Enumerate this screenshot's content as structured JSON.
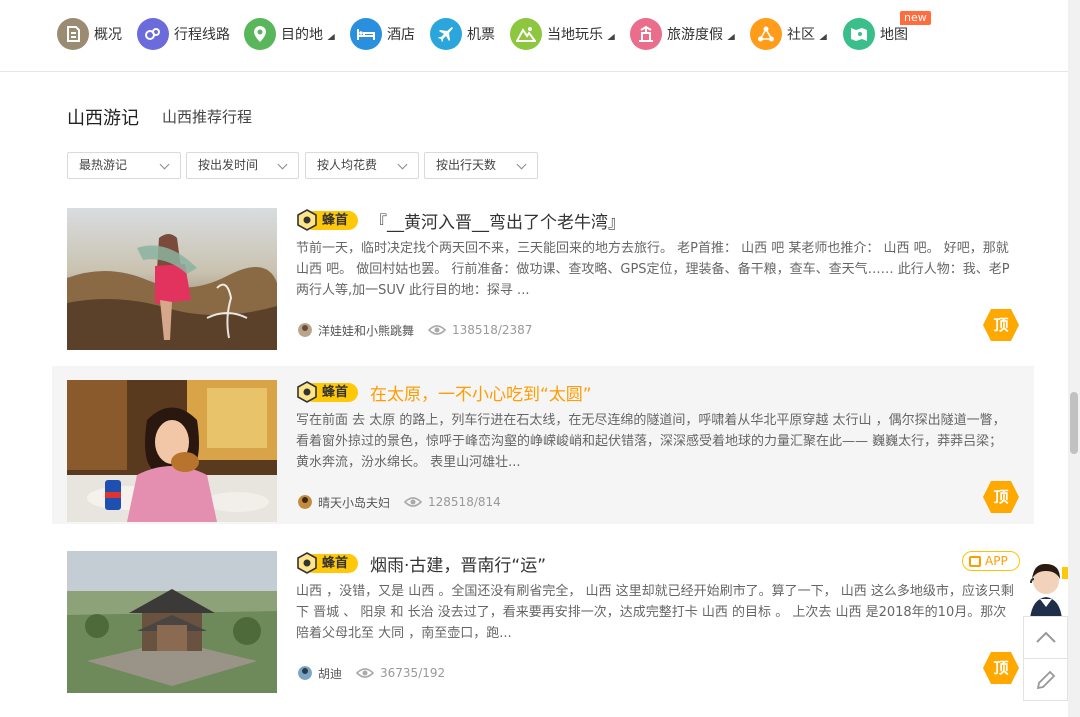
{
  "nav": [
    {
      "label": "概况",
      "icon": "overview-icon",
      "color": "#9b8b73",
      "caret": false
    },
    {
      "label": "行程线路",
      "icon": "route-icon",
      "color": "#6b6bdc",
      "caret": false
    },
    {
      "label": "目的地",
      "icon": "location-pin-icon",
      "color": "#59b65a",
      "caret": true
    },
    {
      "label": "酒店",
      "icon": "bed-icon",
      "color": "#2a8fdc",
      "caret": false
    },
    {
      "label": "机票",
      "icon": "airplane-icon",
      "color": "#2aa6dd",
      "caret": false
    },
    {
      "label": "当地玩乐",
      "icon": "mountain-icon",
      "color": "#8dc63f",
      "caret": true
    },
    {
      "label": "旅游度假",
      "icon": "vacation-icon",
      "color": "#ea6d8b",
      "caret": true
    },
    {
      "label": "社区",
      "icon": "community-icon",
      "color": "#ff9c1a",
      "caret": true
    },
    {
      "label": "地图",
      "icon": "map-icon",
      "color": "#3bbf8a",
      "caret": false
    }
  ],
  "new_badge": "new",
  "section": {
    "title": "山西游记",
    "link": "山西推荐行程"
  },
  "filters": [
    "最热游记",
    "按出发时间",
    "按人均花费",
    "按出行天数"
  ],
  "articles": [
    {
      "badge": "蜂首",
      "title": "『__黄河入晋__弯出了个老牛湾』",
      "excerpt": "节前一天，临时决定找个两天回不来，三天能回来的地方去旅行。 老P首推：  山西 吧 某老师也推介：  山西 吧。 好吧，那就 山西 吧。 做回村姑也罢。 行前准备：做功课、查攻略、GPS定位，理装备、备干粮，查车、查天气…… 此行人物：我、老P两行人等,加一SUV 此行目的地：探寻 ...",
      "author": "洋娃娃和小熊跳舞",
      "stats": "138518/2387",
      "top_label": "顶",
      "highlight": false,
      "app": false
    },
    {
      "badge": "蜂首",
      "title": "在太原，一不小心吃到“太圆”",
      "excerpt": "写在前面 去 太原 的路上，列车行进在石太线，在无尽连绵的隧道间，呼啸着从华北平原穿越 太行山 ，偶尔探出隧道一瞥，看着窗外掠过的景色，惊呼于峰峦沟壑的峥嵘峻峭和起伏错落，深深感受着地球的力量汇聚在此—— 巍巍太行，莽莽吕梁；  黄水奔流，汾水绵长。  表里山河雄壮...",
      "author": "晴天小岛夫妇",
      "stats": "128518/814",
      "top_label": "顶",
      "highlight": true,
      "app": false
    },
    {
      "badge": "蜂首",
      "title": "烟雨·古建，晋南行“运”",
      "excerpt": "山西 ，没错，又是 山西 。全国还没有刷省完全，  山西 这里却就已经开始刷市了。算了一下， 山西 这么多地级市，应该只剩下 晋城 、 阳泉 和 长治 没去过了，看来要再安排一次，达成完整打卡 山西 的目标 。 上次去 山西 是2018年的10月。那次陪着父母北至 大同 ，南至壶口，跑...",
      "author": "胡迪",
      "stats": "36735/192",
      "top_label": "顶",
      "highlight": false,
      "app": true,
      "app_label": "APP"
    }
  ],
  "colors": {
    "accent": "#ffc90a",
    "orange": "#ff9d00",
    "top_hex": "#ffa800"
  }
}
